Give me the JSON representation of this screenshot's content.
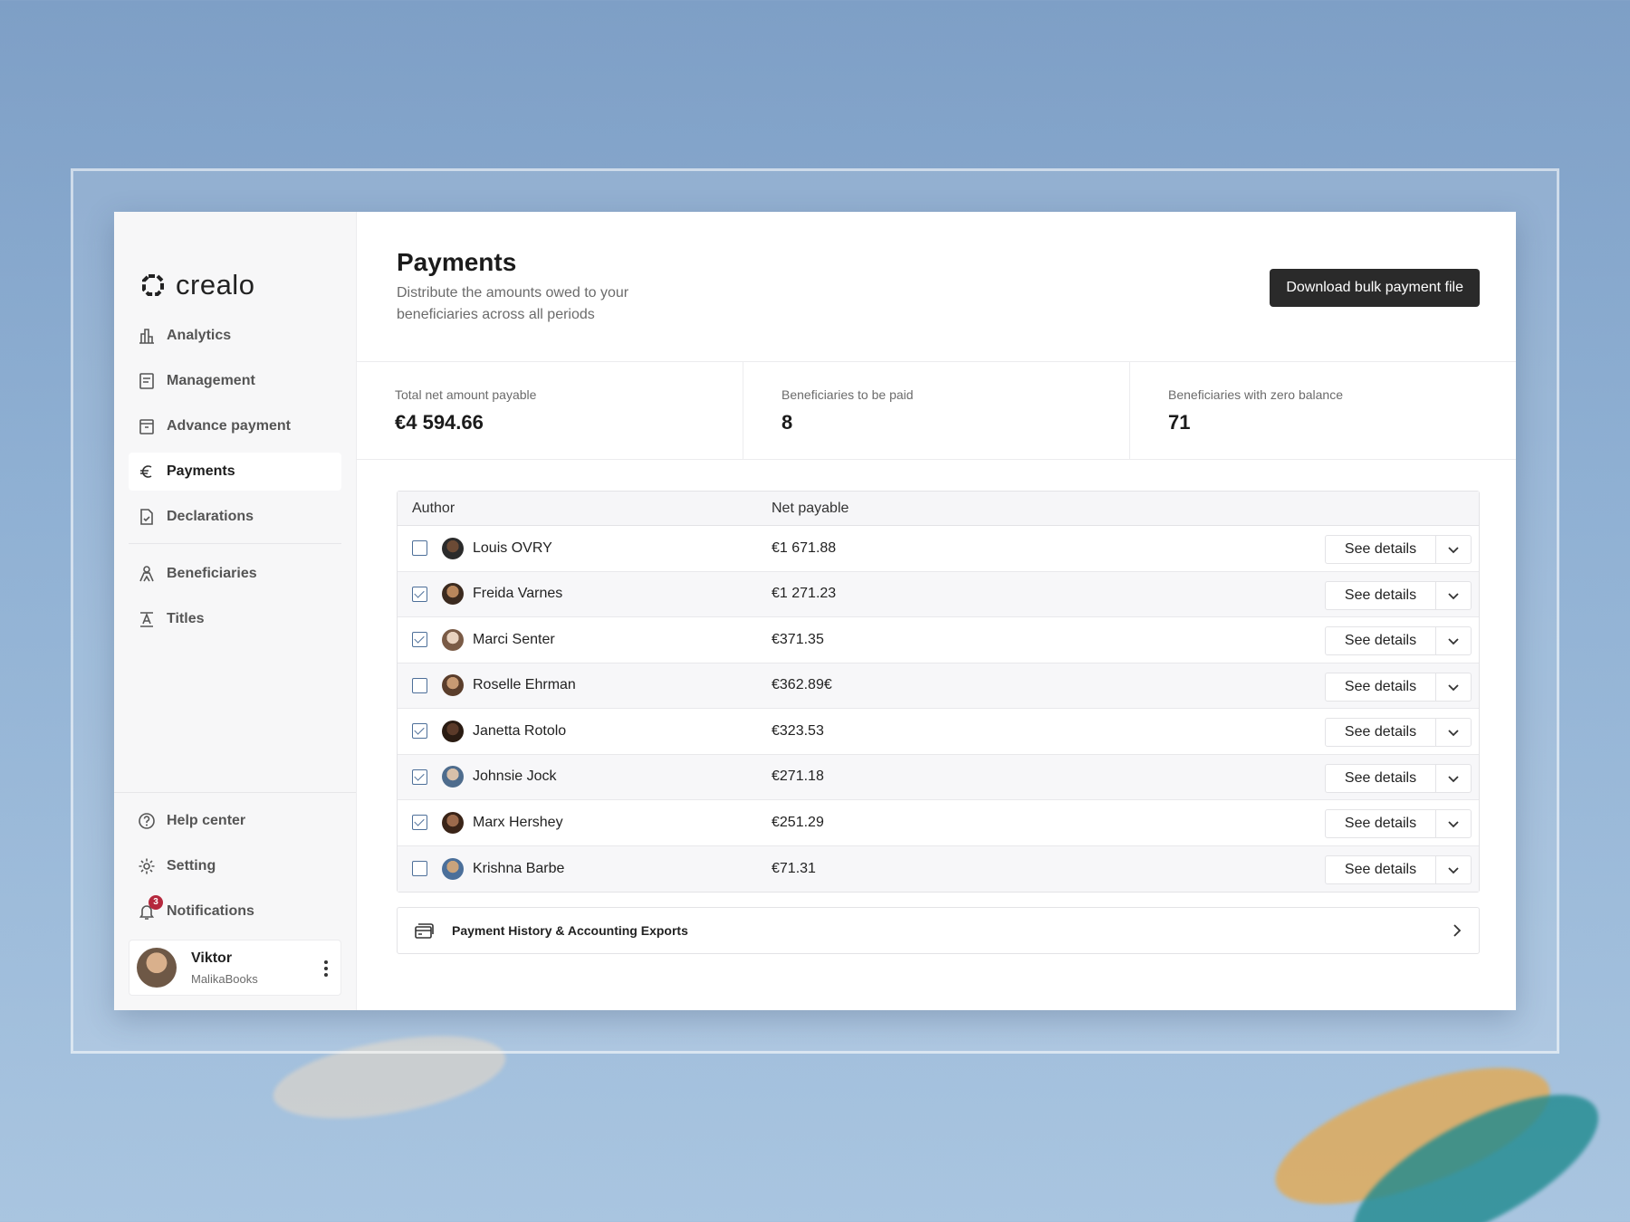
{
  "app": {
    "logo_text": "crealo"
  },
  "sidebar": {
    "items": [
      {
        "label": "Analytics",
        "icon": "bar-chart-icon"
      },
      {
        "label": "Management",
        "icon": "document-icon"
      },
      {
        "label": "Advance payment",
        "icon": "archive-box-icon"
      },
      {
        "label": "Payments",
        "icon": "euro-icon",
        "active": true
      },
      {
        "label": "Declarations",
        "icon": "file-check-icon"
      },
      {
        "label": "Beneficiaries",
        "icon": "users-icon"
      },
      {
        "label": "Titles",
        "icon": "text-title-icon"
      }
    ],
    "bottom": [
      {
        "label": "Help center",
        "icon": "help-circle-icon"
      },
      {
        "label": "Setting",
        "icon": "gear-icon"
      },
      {
        "label": "Notifications",
        "icon": "bell-icon",
        "badge": "3"
      }
    ],
    "profile": {
      "name": "Viktor",
      "org": "MalikaBooks"
    }
  },
  "header": {
    "title": "Payments",
    "subtitle": "Distribute the amounts owed to your beneficiaries across all periods",
    "download_label": "Download bulk payment file"
  },
  "stats": [
    {
      "label": "Total net amount payable",
      "value": "€4 594.66"
    },
    {
      "label": "Beneficiaries to be paid",
      "value": "8"
    },
    {
      "label": "Beneficiaries with zero balance",
      "value": "71"
    }
  ],
  "table": {
    "columns": [
      "Author",
      "Net payable"
    ],
    "action_label": "See details",
    "rows": [
      {
        "name": "Louis OVRY",
        "amount": "€1 671.88",
        "checked": false
      },
      {
        "name": "Freida Varnes",
        "amount": "€1 271.23",
        "checked": true
      },
      {
        "name": "Marci Senter",
        "amount": "€371.35",
        "checked": true
      },
      {
        "name": "Roselle Ehrman",
        "amount": "€362.89€",
        "checked": false
      },
      {
        "name": "Janetta Rotolo",
        "amount": "€323.53",
        "checked": true
      },
      {
        "name": "Johnsie Jock",
        "amount": "€271.18",
        "checked": true
      },
      {
        "name": "Marx Hershey",
        "amount": "€251.29",
        "checked": true
      },
      {
        "name": "Krishna Barbe",
        "amount": "€71.31",
        "checked": false
      }
    ]
  },
  "history": {
    "label": "Payment History & Accounting Exports"
  },
  "colors": {
    "accent_dark": "#2a2a2a",
    "checkbox": "#4d6f99",
    "badge": "#b5283d"
  }
}
